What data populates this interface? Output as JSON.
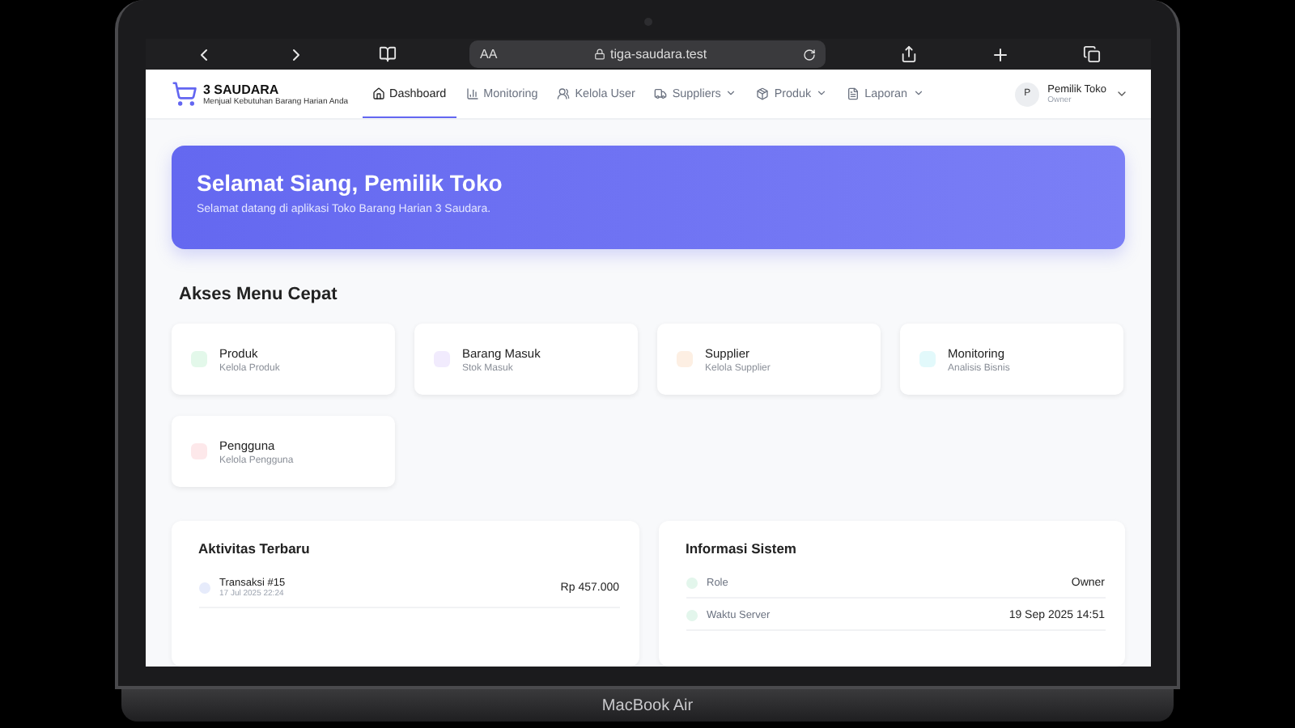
{
  "browser": {
    "text_size": "AA",
    "url": "tiga-saudara.test"
  },
  "brand": {
    "name": "3 SAUDARA",
    "tagline": "Menjual Kebutuhan Barang Harian Anda"
  },
  "nav": [
    {
      "label": "Dashboard",
      "selected": true,
      "dropdown": false
    },
    {
      "label": "Monitoring",
      "selected": false,
      "dropdown": false
    },
    {
      "label": "Kelola User",
      "selected": false,
      "dropdown": false
    },
    {
      "label": "Suppliers",
      "selected": false,
      "dropdown": true
    },
    {
      "label": "Produk",
      "selected": false,
      "dropdown": true
    },
    {
      "label": "Laporan",
      "selected": false,
      "dropdown": true
    }
  ],
  "user": {
    "initial": "P",
    "name": "Pemilik Toko",
    "role": "Owner"
  },
  "banner": {
    "title": "Selamat Siang, Pemilik Toko",
    "subtitle": "Selamat datang di aplikasi Toko Barang Harian 3 Saudara."
  },
  "quick_menu": {
    "title": "Akses Menu Cepat",
    "items": [
      {
        "title": "Produk",
        "subtitle": "Kelola Produk",
        "color": "#e3f8ea"
      },
      {
        "title": "Barang Masuk",
        "subtitle": "Stok Masuk",
        "color": "#f1ebfd"
      },
      {
        "title": "Supplier",
        "subtitle": "Kelola Supplier",
        "color": "#fdefe3"
      },
      {
        "title": "Monitoring",
        "subtitle": "Analisis Bisnis",
        "color": "#e2f9fb"
      },
      {
        "title": "Pengguna",
        "subtitle": "Kelola Pengguna",
        "color": "#fde8ea"
      }
    ]
  },
  "activity": {
    "title": "Aktivitas Terbaru",
    "items": [
      {
        "title": "Transaksi #15",
        "time": "17 Jul 2025 22:24",
        "amount": "Rp 457.000"
      }
    ]
  },
  "system_info": {
    "title": "Informasi Sistem",
    "rows": [
      {
        "label": "Role",
        "value": "Owner"
      },
      {
        "label": "Waktu Server",
        "value": "19 Sep 2025 14:51"
      }
    ]
  },
  "device": {
    "label": "MacBook Air"
  }
}
